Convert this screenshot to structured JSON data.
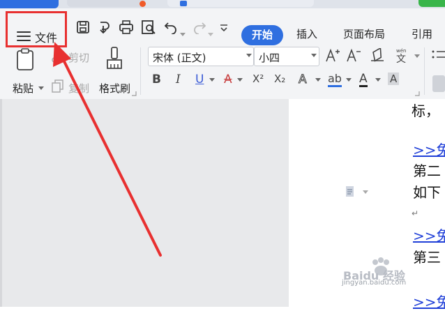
{
  "ribbon": {
    "file_label": "文件",
    "tabs": [
      {
        "label": "开始",
        "active": true
      },
      {
        "label": "插入",
        "active": false
      },
      {
        "label": "页面布局",
        "active": false
      },
      {
        "label": "引用",
        "active": false
      }
    ],
    "clipboard": {
      "paste_label": "粘贴",
      "cut_label": "剪切",
      "copy_label": "复制",
      "format_painter_label": "格式刷"
    },
    "font": {
      "family": "宋体 (正文)",
      "size": "小四"
    },
    "format_buttons": [
      "B",
      "I",
      "U",
      "A",
      "X²",
      "X₂",
      "A",
      "ab",
      "A",
      "A"
    ]
  },
  "document": {
    "lines": [
      {
        "text": "标，",
        "link": false
      },
      {
        "text": ">>免",
        "link": true
      },
      {
        "text": "第二",
        "link": false
      },
      {
        "text": "如下",
        "link": false
      },
      {
        "text": ">>免",
        "link": true
      },
      {
        "text": "第三",
        "link": false
      },
      {
        "text": ">>免",
        "link": true
      }
    ]
  },
  "watermark": {
    "brand": "Baidu 经验",
    "url": "jingyan.baidu.com"
  },
  "colors": {
    "accent": "#2f6fe0",
    "highlight": "#e83030",
    "link": "#1f3fd8"
  }
}
